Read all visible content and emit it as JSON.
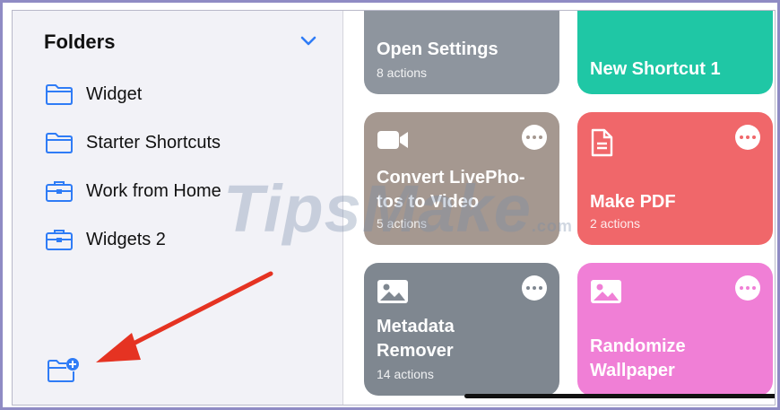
{
  "sidebar": {
    "title": "Folders",
    "items": [
      {
        "label": "Widget",
        "icon": "folder-icon"
      },
      {
        "label": "Starter Shortcuts",
        "icon": "folder-icon"
      },
      {
        "label": "Work from Home",
        "icon": "briefcase-folder-icon"
      },
      {
        "label": "Widgets 2",
        "icon": "briefcase-folder-icon"
      }
    ],
    "new_folder_icon": "new-folder-icon",
    "accent": "#2f7cf6"
  },
  "shortcuts": [
    {
      "title": "Open Settings",
      "subtitle": "8 actions",
      "color": "#8e959e"
    },
    {
      "title": "New Shortcut 1",
      "subtitle": "",
      "color": "#1fc7a5"
    },
    {
      "title": "Convert LivePho-tos to Video",
      "title_line1": "Convert LivePho-",
      "title_line2": "tos to Video",
      "subtitle": "5 actions",
      "color": "#a59890",
      "icon": "video-camera-icon"
    },
    {
      "title": "Make PDF",
      "subtitle": "2 actions",
      "color": "#f0676a",
      "icon": "document-icon"
    },
    {
      "title": "Metadata Remover",
      "title_line1": "Metadata",
      "title_line2": "Remover",
      "subtitle": "14 actions",
      "color": "#7f8790",
      "icon": "photo-icon"
    },
    {
      "title": "Randomize Wallpaper",
      "title_line1": "Randomize",
      "title_line2": "Wallpaper",
      "subtitle": "",
      "color": "#f07fd6",
      "icon": "photo-icon"
    }
  ],
  "watermark": {
    "text": "TipsMake",
    "suffix": ".com"
  },
  "annotation_color": "#e53322"
}
